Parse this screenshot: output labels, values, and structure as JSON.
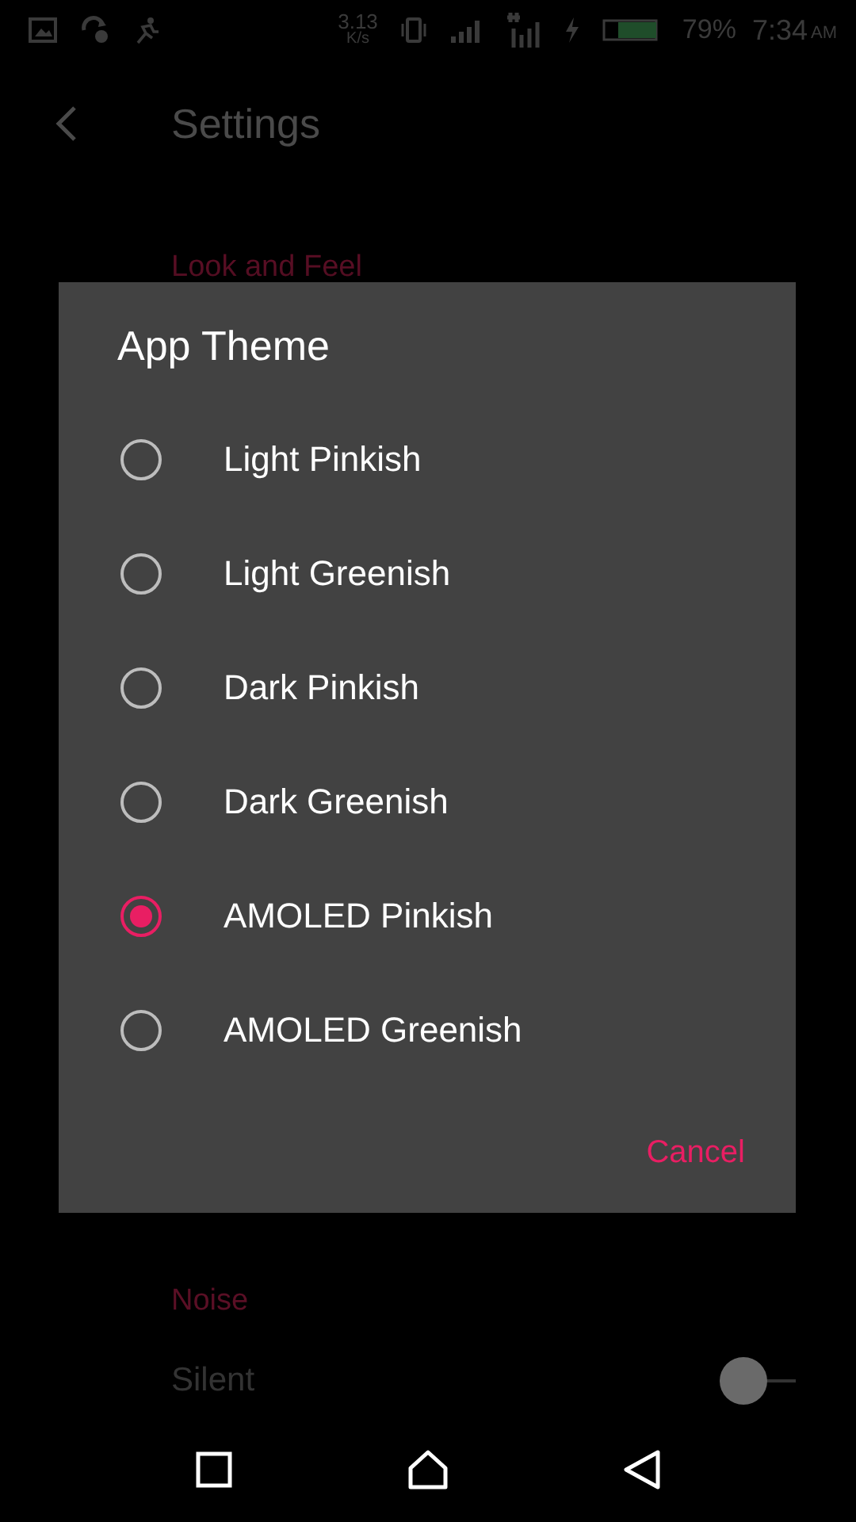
{
  "status_bar": {
    "speed": "3.13",
    "speed_unit": "K/s",
    "battery_percent": "79%",
    "time": "7:34",
    "ampm": "AM"
  },
  "toolbar": {
    "title": "Settings"
  },
  "sections": [
    {
      "header": "Look and Feel"
    },
    {
      "header": "Noise",
      "rows": [
        {
          "label": "Silent",
          "on": false
        }
      ]
    }
  ],
  "dialog": {
    "title": "App Theme",
    "options": [
      {
        "label": "Light Pinkish",
        "selected": false
      },
      {
        "label": "Light Greenish",
        "selected": false
      },
      {
        "label": "Dark Pinkish",
        "selected": false
      },
      {
        "label": "Dark Greenish",
        "selected": false
      },
      {
        "label": "AMOLED Pinkish",
        "selected": true
      },
      {
        "label": "AMOLED Greenish",
        "selected": false
      }
    ],
    "button": "Cancel"
  }
}
